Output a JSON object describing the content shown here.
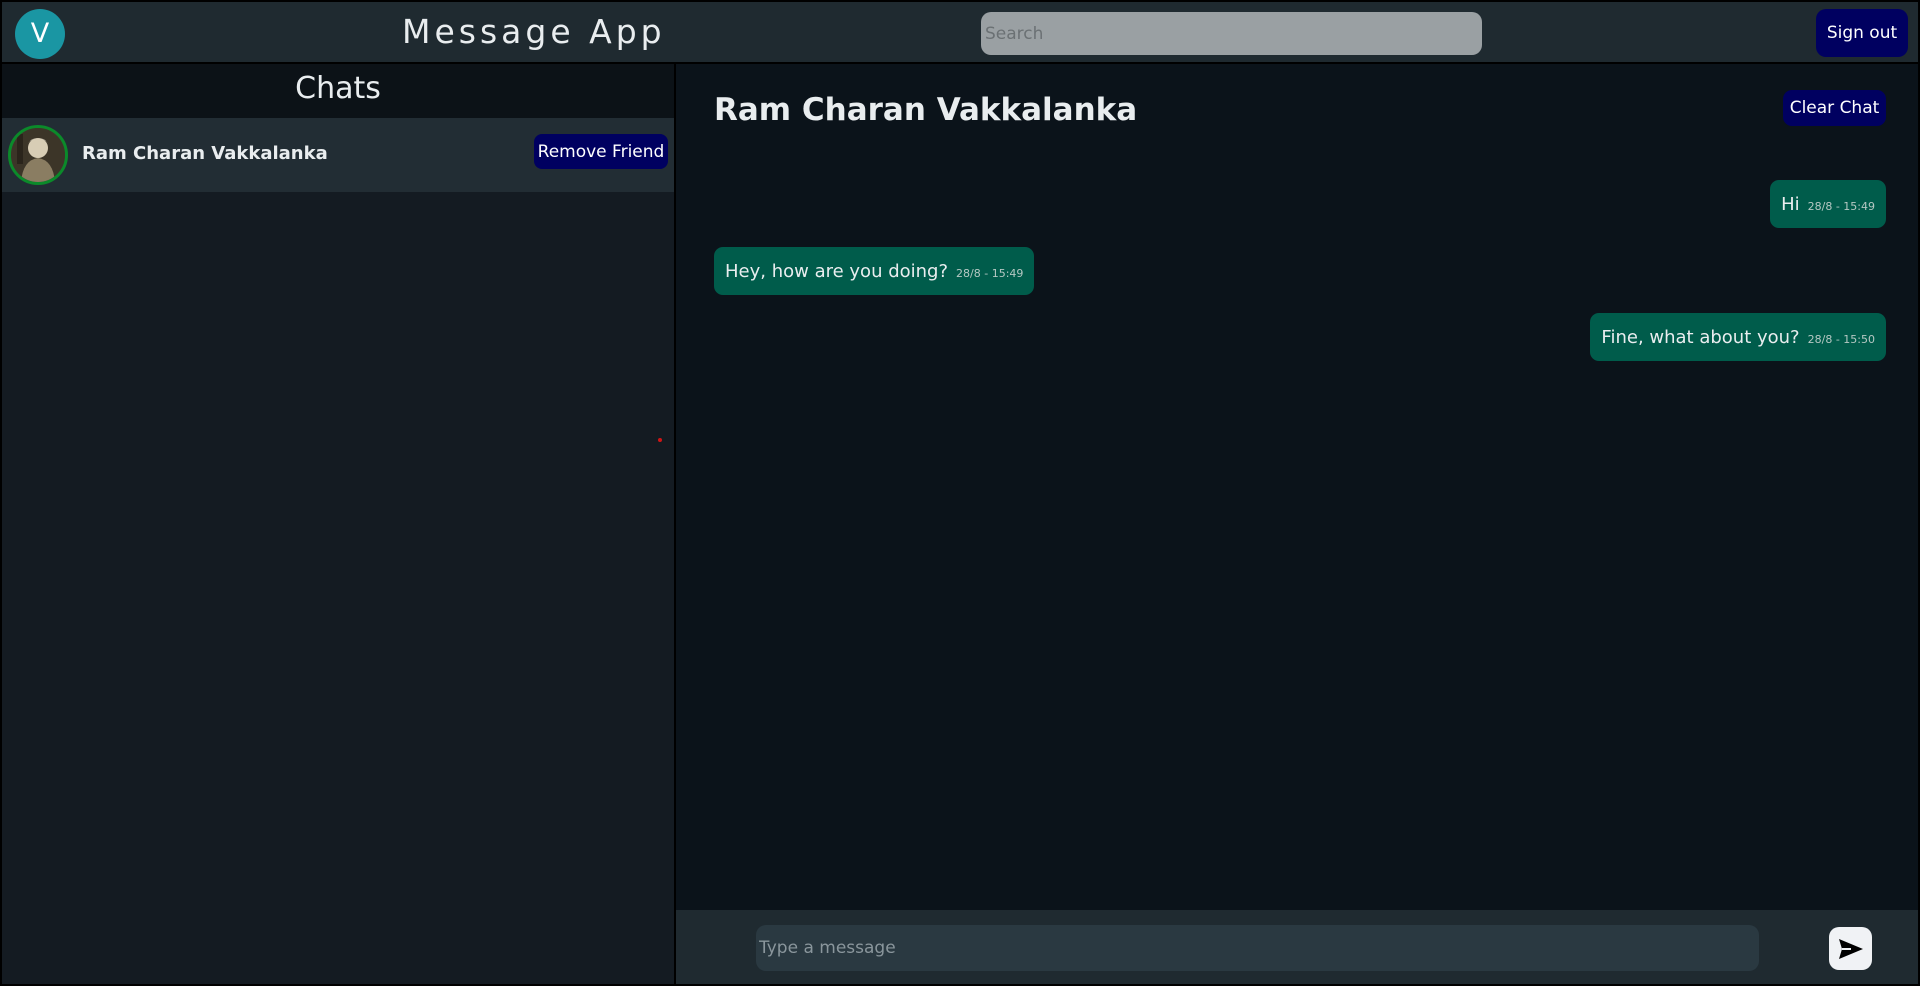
{
  "header": {
    "avatar_initial": "V",
    "title": "Message App",
    "search_placeholder": "Search",
    "signout_label": "Sign out"
  },
  "sidebar": {
    "title": "Chats",
    "chats": [
      {
        "name": "Ram Charan Vakkalanka",
        "action_label": "Remove Friend"
      }
    ]
  },
  "chat": {
    "title": "Ram Charan Vakkalanka",
    "clear_label": "Clear Chat",
    "messages": [
      {
        "text": "Hi",
        "time": "28/8 - 15:49",
        "direction": "outgoing"
      },
      {
        "text": "Hey, how are you doing?",
        "time": "28/8 - 15:49",
        "direction": "incoming"
      },
      {
        "text": "Fine, what about you?",
        "time": "28/8 - 15:50",
        "direction": "outgoing"
      }
    ],
    "input_placeholder": "Type a message",
    "send_icon": "send-icon"
  },
  "colors": {
    "header_bg": "#1f2a30",
    "button_bg": "#000060",
    "bubble_bg": "#005c4b",
    "avatar_bg": "#1a96a3"
  }
}
